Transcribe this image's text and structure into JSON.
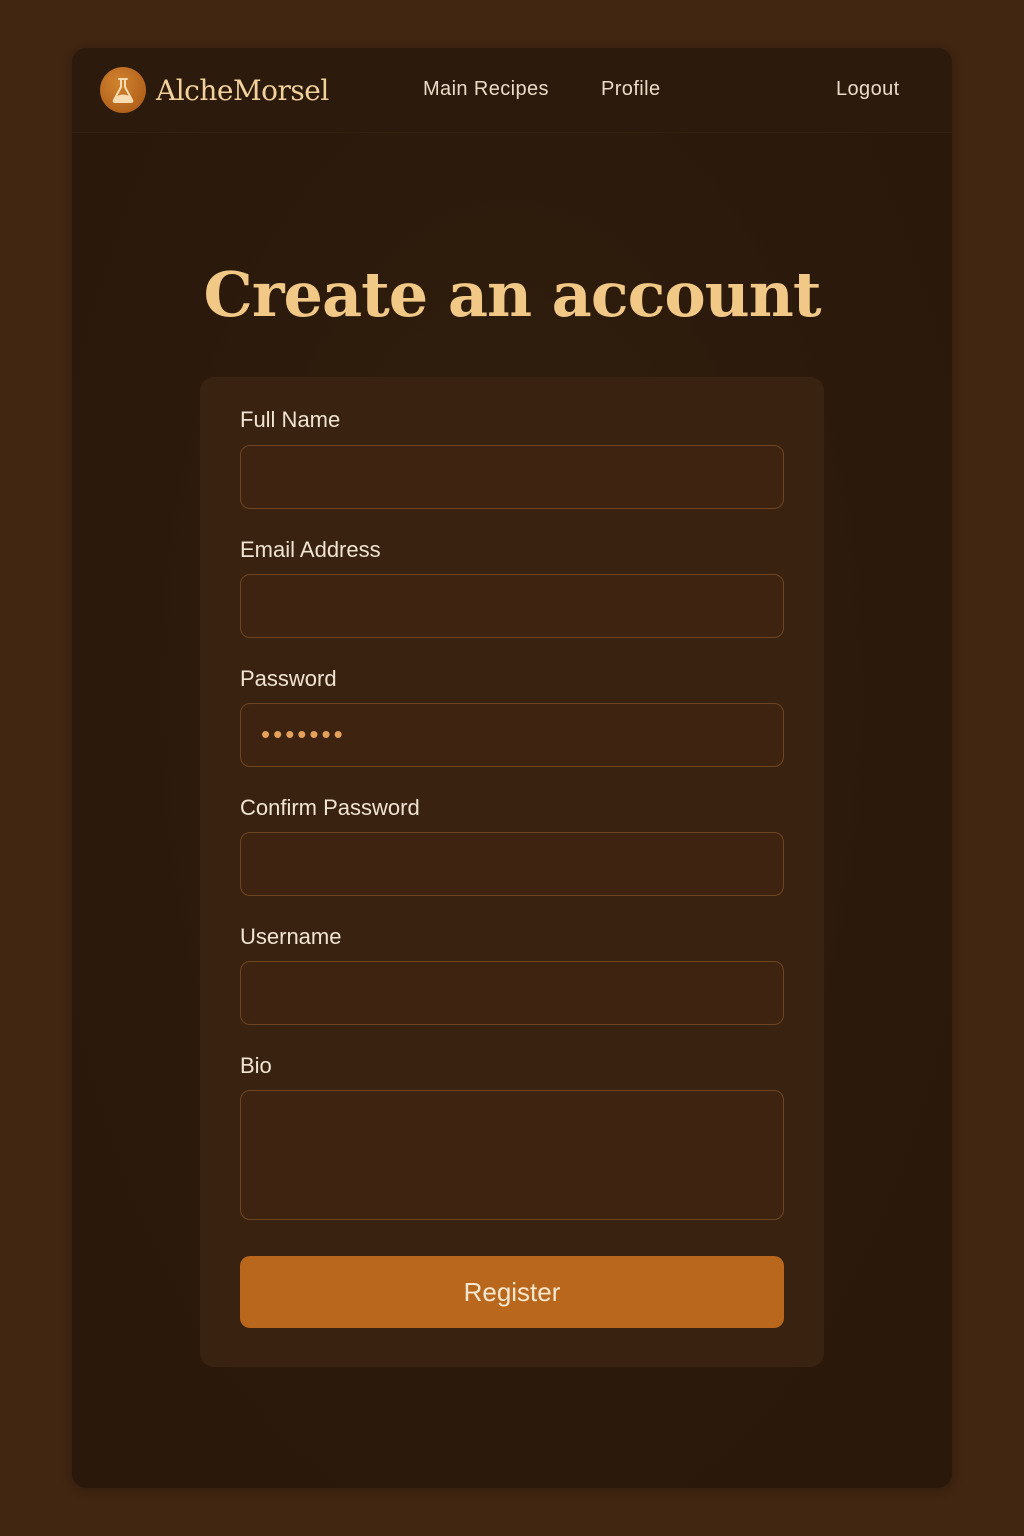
{
  "app": {
    "name": "AlcheMorsel",
    "logo_icon": "alchemy-flask-icon"
  },
  "nav": {
    "main_recipes": "Main Recipes",
    "profile": "Profile",
    "logout": "Logout"
  },
  "page": {
    "title": "Create an account"
  },
  "form": {
    "full_name": {
      "label": "Full Name",
      "value": ""
    },
    "email": {
      "label": "Email Address",
      "value": ""
    },
    "password": {
      "label": "Password",
      "masked_value": "•••••••"
    },
    "confirm_password": {
      "label": "Confirm Password",
      "value": ""
    },
    "username": {
      "label": "Username",
      "value": ""
    },
    "bio": {
      "label": "Bio",
      "value": ""
    },
    "submit_label": "Register"
  },
  "colors": {
    "background": "#412611",
    "panel": "#2b190b",
    "card": "#3a2210",
    "accent": "#b9671c",
    "title": "#f1c886"
  }
}
